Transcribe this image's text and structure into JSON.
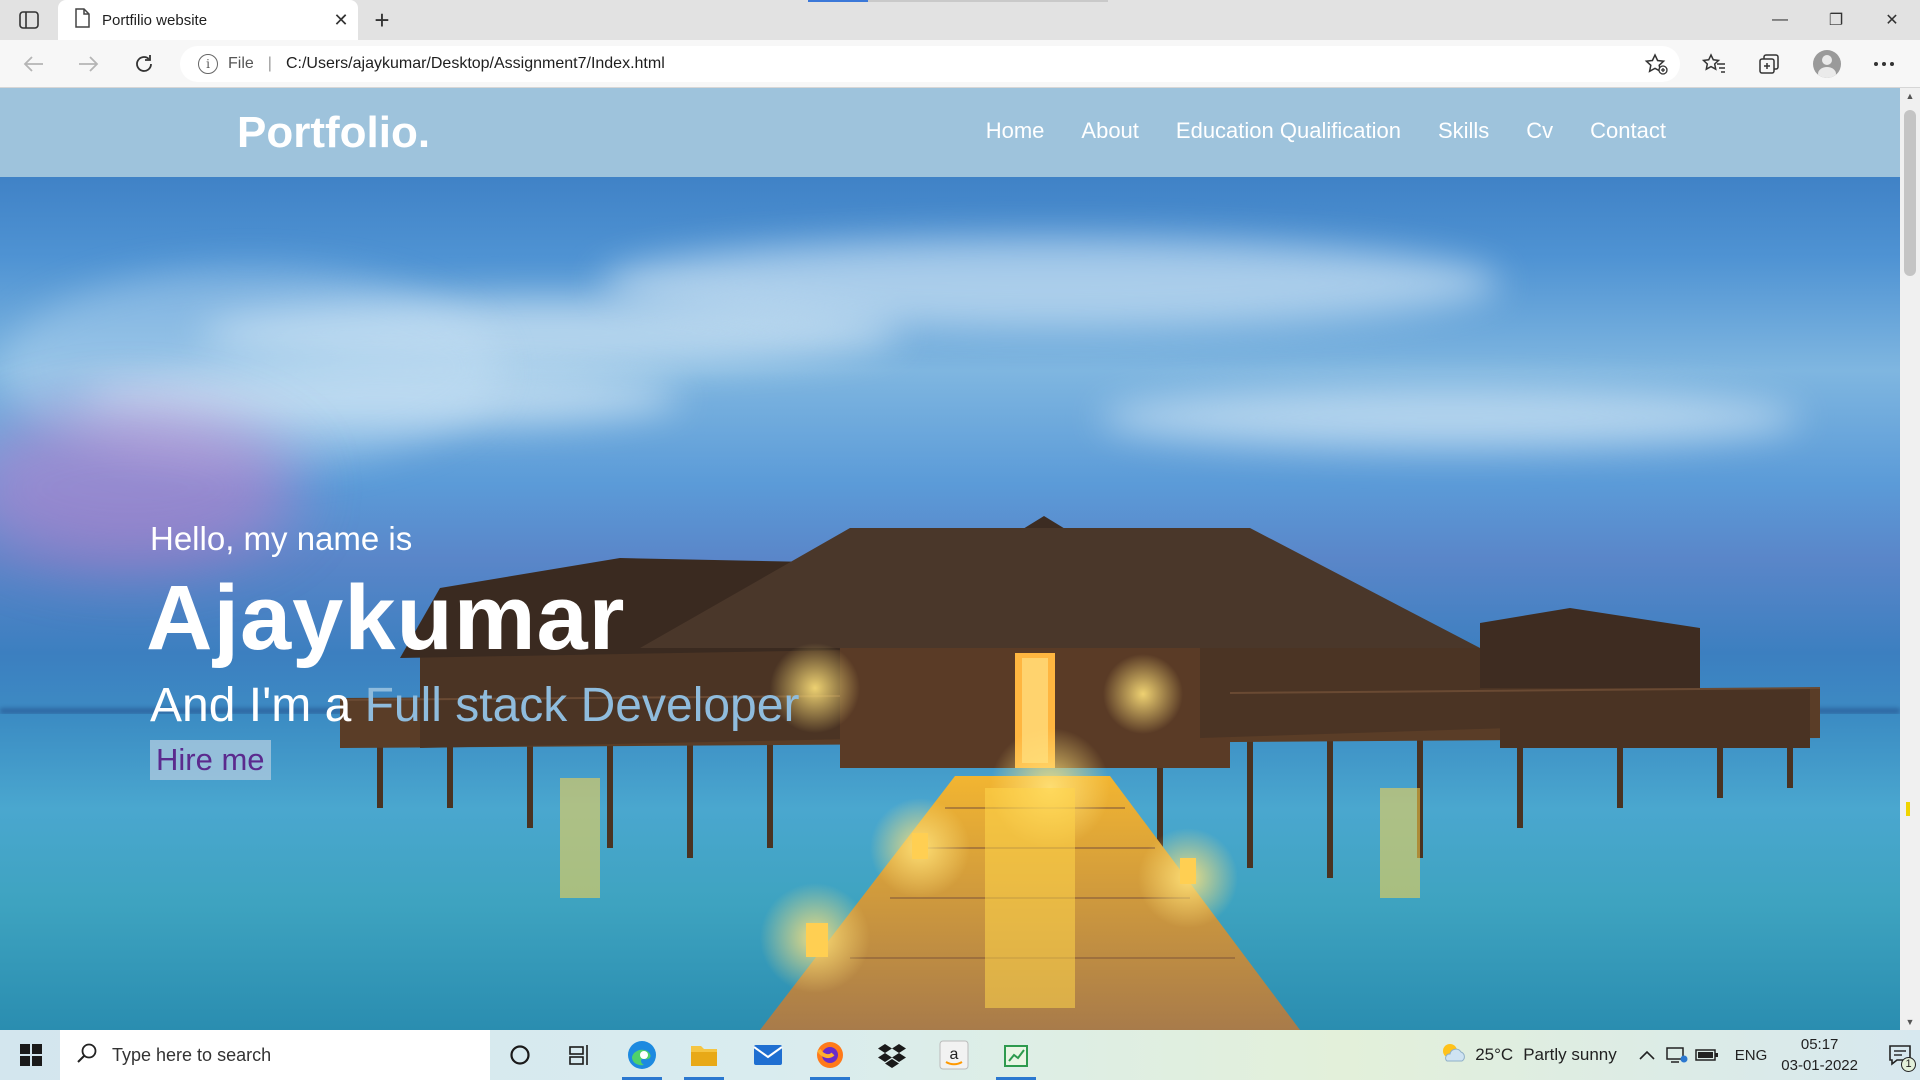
{
  "browser": {
    "tab_title": "Portfilio website",
    "tab_close": "✕",
    "new_tab": "+",
    "url_scheme": "File",
    "url_separator": "|",
    "url_path": "C:/Users/ajaykumar/Desktop/Assignment7/Index.html",
    "window_controls": {
      "minimize": "—",
      "restore": "❐",
      "close": "✕"
    }
  },
  "site": {
    "brand": "Portfolio.",
    "nav": [
      "Home",
      "About",
      "Education Qualification",
      "Skills",
      "Cv",
      "Contact"
    ],
    "hero": {
      "greeting": "Hello, my name is",
      "name": "Ajaykumar",
      "role_prefix": "And I'm a ",
      "role_typed": "Full stack Developer",
      "cta": "Hire me"
    },
    "colors": {
      "navbar": "#9ec3dc",
      "typed_text": "#8fbcdd",
      "cta_text": "#5b2a8e"
    }
  },
  "taskbar": {
    "search_placeholder": "Type here to search",
    "weather_temp": "25°C",
    "weather_condition": "Partly sunny",
    "language": "ENG",
    "time": "05:17",
    "date": "03-01-2022",
    "notification_count": "1",
    "pinned_apps": [
      "cortana-icon",
      "task-view-icon",
      "edge-icon",
      "file-explorer-icon",
      "mail-icon",
      "firefox-icon",
      "dropbox-icon",
      "amazon-icon",
      "sheets-icon"
    ]
  }
}
